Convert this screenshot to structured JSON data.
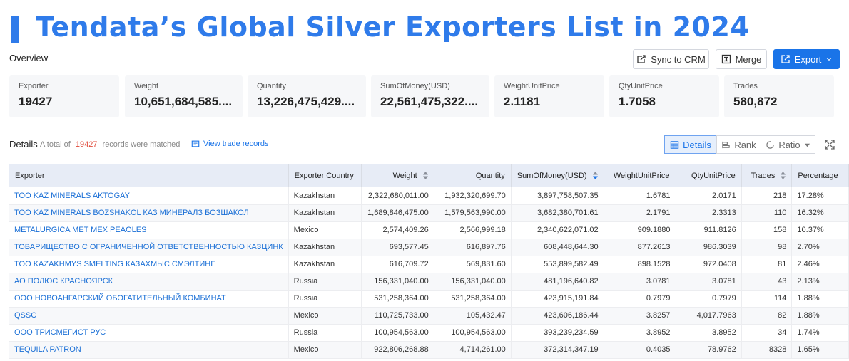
{
  "title": "Tendata’s Global Silver Exporters List in 2024",
  "overview_label": "Overview",
  "actions": {
    "sync_label": "Sync to CRM",
    "merge_label": "Merge",
    "export_label": "Export"
  },
  "stats": [
    {
      "label": "Exporter",
      "value": "19427"
    },
    {
      "label": "Weight",
      "value": "10,651,684,585...."
    },
    {
      "label": "Quantity",
      "value": "13,226,475,429...."
    },
    {
      "label": "SumOfMoney(USD)",
      "value": "22,561,475,322...."
    },
    {
      "label": "WeightUnitPrice",
      "value": "2.1181"
    },
    {
      "label": "QtyUnitPrice",
      "value": "1.7058"
    },
    {
      "label": "Trades",
      "value": "580,872"
    }
  ],
  "details": {
    "label": "Details",
    "total_prefix": "A total of",
    "total_count": "19427",
    "total_suffix": "records were matched",
    "view_trade": "View trade records",
    "tabs": {
      "details": "Details",
      "rank": "Rank",
      "ratio": "Ratio"
    }
  },
  "table": {
    "headers": [
      "Exporter",
      "Exporter Country",
      "Weight",
      "Quantity",
      "SumOfMoney(USD)",
      "WeightUnitPrice",
      "QtyUnitPrice",
      "Trades",
      "Percentage"
    ],
    "rows": [
      [
        "TOO KAZ MINERALS AKTOGAY",
        "Kazakhstan",
        "2,322,680,011.00",
        "1,932,320,699.70",
        "3,897,758,507.35",
        "1.6781",
        "2.0171",
        "218",
        "17.28%"
      ],
      [
        "TOO KAZ MINERALS BOZSHAKOL КАЗ МИНЕРАЛЗ БОЗШАКОЛ",
        "Kazakhstan",
        "1,689,846,475.00",
        "1,579,563,990.00",
        "3,682,380,701.61",
        "2.1791",
        "2.3313",
        "110",
        "16.32%"
      ],
      [
        "METALURGICA MET MEX PEAOLES",
        "Mexico",
        "2,574,409.26",
        "2,566,999.18",
        "2,340,622,071.02",
        "909.1880",
        "911.8126",
        "158",
        "10.37%"
      ],
      [
        "ТОВАРИЩЕСТВО С ОГРАНИЧЕННОЙ ОТВЕТСТВЕННОСТЬЮ КАЗЦИНК",
        "Kazakhstan",
        "693,577.45",
        "616,897.76",
        "608,448,644.30",
        "877.2613",
        "986.3039",
        "98",
        "2.70%"
      ],
      [
        "TOO KAZAKHMYS SMELTING КАЗАХМЫС СМЭЛТИНГ",
        "Kazakhstan",
        "616,709.72",
        "569,831.60",
        "553,899,582.49",
        "898.1528",
        "972.0408",
        "81",
        "2.46%"
      ],
      [
        "АО ПОЛЮС КРАСНОЯРСК",
        "Russia",
        "156,331,040.00",
        "156,331,040.00",
        "481,196,640.82",
        "3.0781",
        "3.0781",
        "43",
        "2.13%"
      ],
      [
        "ООО НОВОАНГАРСКИЙ ОБОГАТИТЕЛЬНЫЙ КОМБИНАТ",
        "Russia",
        "531,258,364.00",
        "531,258,364.00",
        "423,915,191.84",
        "0.7979",
        "0.7979",
        "114",
        "1.88%"
      ],
      [
        "QSSC",
        "Mexico",
        "110,725,733.00",
        "105,432.47",
        "423,606,186.44",
        "3.8257",
        "4,017.7963",
        "82",
        "1.88%"
      ],
      [
        "ООО ТРИСМЕГИСТ РУС",
        "Russia",
        "100,954,563.00",
        "100,954,563.00",
        "393,239,234.59",
        "3.8952",
        "3.8952",
        "34",
        "1.74%"
      ],
      [
        "TEQUILA PATRON",
        "Mexico",
        "922,806,268.88",
        "4,714,261.00",
        "372,314,347.19",
        "0.4035",
        "78.9762",
        "8328",
        "1.65%"
      ]
    ]
  },
  "colors": {
    "accent": "#2f7bea",
    "link": "#1a6fd6",
    "highlight_count": "#e04a3a"
  }
}
